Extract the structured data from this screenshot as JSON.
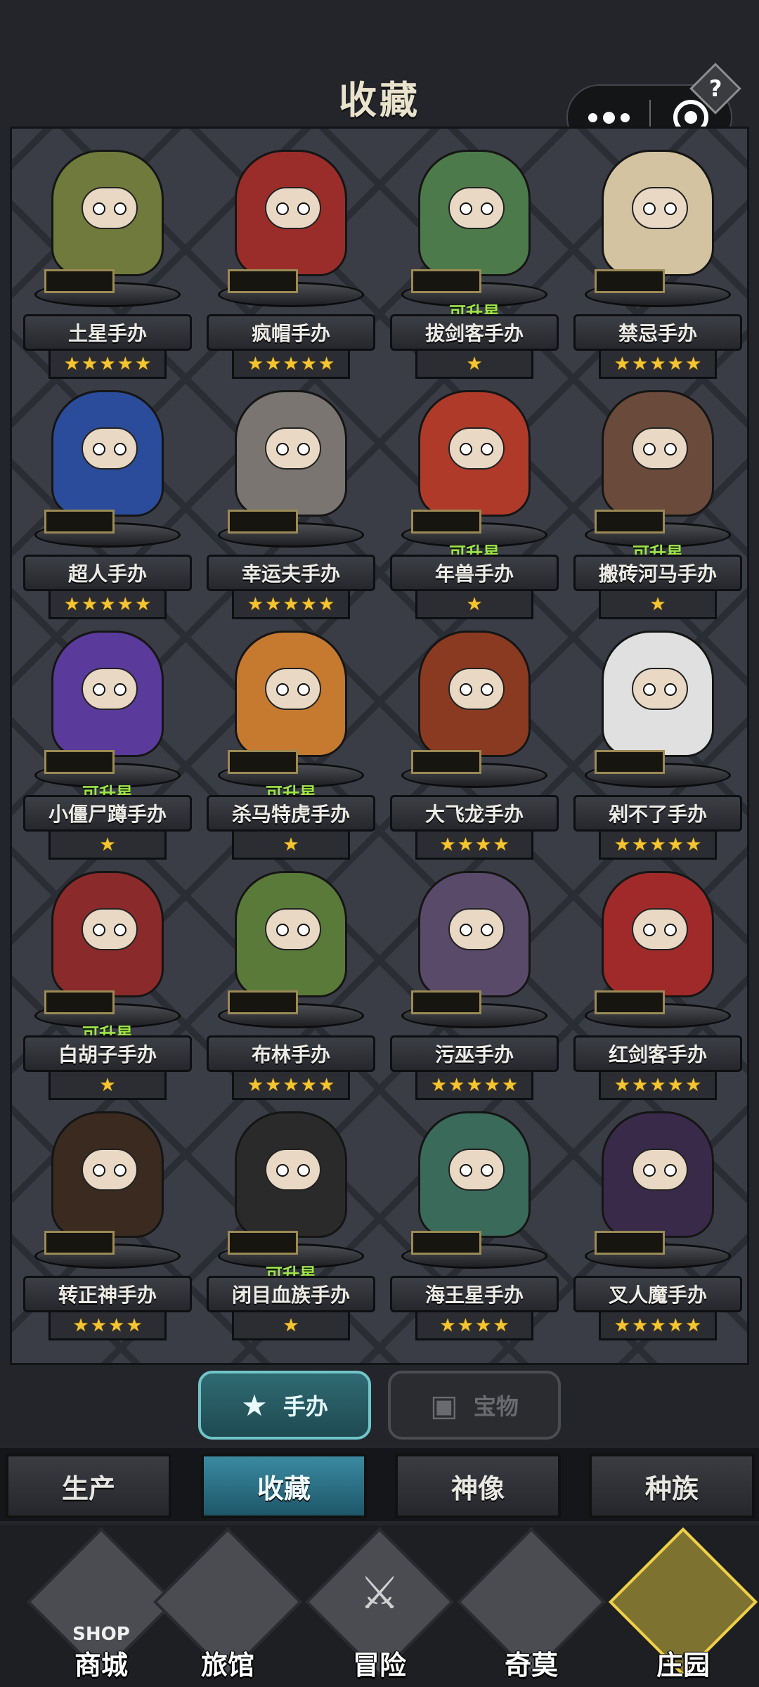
{
  "header": {
    "title": "收藏",
    "help": "?"
  },
  "cards": [
    {
      "name": "土星手办",
      "stars": 5,
      "upgrade": "",
      "color": "#6f7a3c"
    },
    {
      "name": "疯帽手办",
      "stars": 5,
      "upgrade": "",
      "color": "#9a2d2a"
    },
    {
      "name": "拔剑客手办",
      "stars": 1,
      "upgrade": "可升星",
      "color": "#4d7a4a"
    },
    {
      "name": "禁忌手办",
      "stars": 5,
      "upgrade": "",
      "color": "#d3c3a0"
    },
    {
      "name": "超人手办",
      "stars": 5,
      "upgrade": "",
      "color": "#2a4c9a"
    },
    {
      "name": "幸运夫手办",
      "stars": 5,
      "upgrade": "",
      "color": "#7a7570"
    },
    {
      "name": "年兽手办",
      "stars": 1,
      "upgrade": "可升星",
      "color": "#b03a2a"
    },
    {
      "name": "搬砖河马手办",
      "stars": 1,
      "upgrade": "可升星",
      "color": "#6a4a3a"
    },
    {
      "name": "小僵尸蹲手办",
      "stars": 1,
      "upgrade": "可升星",
      "color": "#5a3a9a"
    },
    {
      "name": "杀马特虎手办",
      "stars": 1,
      "upgrade": "可升星",
      "color": "#c57a30"
    },
    {
      "name": "大飞龙手办",
      "stars": 4,
      "upgrade": "",
      "color": "#8a3a20"
    },
    {
      "name": "剁不了手办",
      "stars": 5,
      "upgrade": "",
      "color": "#e0e0e0"
    },
    {
      "name": "白胡子手办",
      "stars": 1,
      "upgrade": "可升星",
      "color": "#8a2a2a"
    },
    {
      "name": "布林手办",
      "stars": 5,
      "upgrade": "",
      "color": "#5a7a3a"
    },
    {
      "name": "污巫手办",
      "stars": 5,
      "upgrade": "",
      "color": "#5a4a6a"
    },
    {
      "name": "红剑客手办",
      "stars": 5,
      "upgrade": "",
      "color": "#a02a2a"
    },
    {
      "name": "转正神手办",
      "stars": 4,
      "upgrade": "",
      "color": "#3a2a20"
    },
    {
      "name": "闭目血族手办",
      "stars": 1,
      "upgrade": "可升星",
      "color": "#2a2a2a"
    },
    {
      "name": "海王星手办",
      "stars": 4,
      "upgrade": "",
      "color": "#3a6a5a"
    },
    {
      "name": "叉人魔手办",
      "stars": 5,
      "upgrade": "",
      "color": "#3a2a4a"
    }
  ],
  "tabs": {
    "figures": "手办",
    "treasures": "宝物"
  },
  "nav": {
    "produce": "生产",
    "collect": "收藏",
    "statue": "神像",
    "race": "种族"
  },
  "bottom": {
    "shop": "商城",
    "shop_sign": "SHOP",
    "inn": "旅馆",
    "adventure": "冒险",
    "qimo": "奇莫",
    "manor": "庄园"
  },
  "icons": {
    "help": "question-icon",
    "more": "more-dots-icon",
    "close": "target-icon",
    "star": "star-icon"
  }
}
